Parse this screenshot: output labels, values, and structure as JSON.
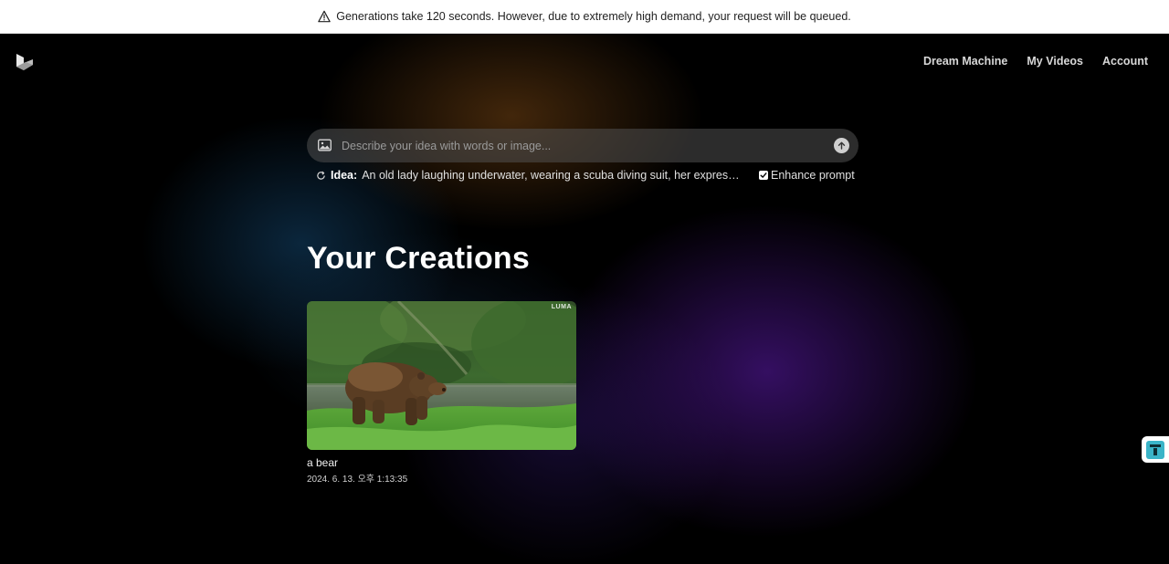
{
  "banner": {
    "text": "Generations take 120 seconds. However, due to extremely high demand, your request will be queued.",
    "icon": "warning-triangle-icon"
  },
  "header": {
    "logo": "luma-logo-icon",
    "nav": [
      {
        "label": "Dream Machine"
      },
      {
        "label": "My Videos"
      },
      {
        "label": "Account"
      }
    ]
  },
  "prompt": {
    "placeholder": "Describe your idea with words or image...",
    "value": "",
    "image_icon": "image-icon",
    "send_icon": "arrow-up-icon"
  },
  "idea": {
    "label": "Idea:",
    "text": "An old lady laughing underwater, wearing a scuba diving suit, her expression d..."
  },
  "enhance": {
    "label": "Enhance prompt",
    "checked": true
  },
  "creations": {
    "title": "Your Creations",
    "items": [
      {
        "title": "a bear",
        "date": "2024. 6. 13. 오후 1:13:35",
        "watermark": "LUMA"
      }
    ]
  },
  "colors": {
    "banner_bg": "#ffffff",
    "page_bg": "#000000",
    "widget_accent": "#3ab4c8"
  }
}
